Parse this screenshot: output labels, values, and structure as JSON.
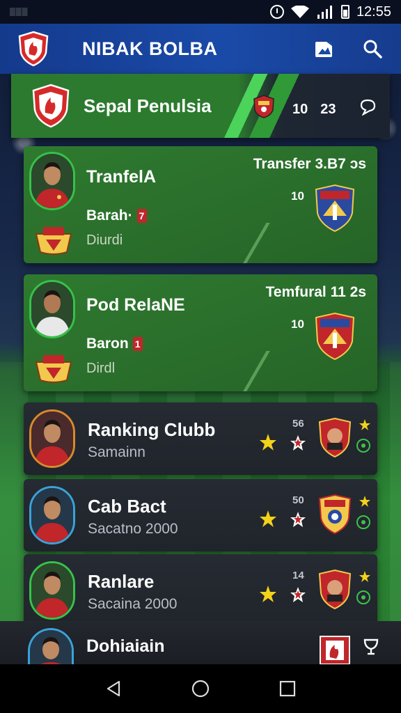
{
  "status_bar": {
    "carrier": "▒▒▒",
    "time": "12:55"
  },
  "app_bar": {
    "title": "NIBAK BOLBA"
  },
  "feature": {
    "title": "Sepal Penulsia",
    "score_left": "10",
    "score_right": "23"
  },
  "transfers": [
    {
      "name": "TranfelA",
      "right_title": "Transfer 3.B7 ɔs",
      "right_num": "10",
      "sub": "Barah·",
      "chip": "7",
      "sub2": "Diurdi"
    },
    {
      "name": "Pod RelaNE",
      "right_title": "Temfural 11 2s",
      "right_num": "10",
      "sub": "Baron",
      "chip": "1",
      "sub2": "Dirdl"
    }
  ],
  "rankings": [
    {
      "name": "Ranking Clubb",
      "sub": "Samainn",
      "num": "56"
    },
    {
      "name": "Cab Bact",
      "sub": "Sacatno 2000",
      "num": "50"
    },
    {
      "name": "Ranlare",
      "sub": "Sacaina 2000",
      "num": "14"
    }
  ],
  "bottom_card": {
    "name": "Dohiaiain"
  },
  "colors": {
    "appbar_blue": "#1a4aa8",
    "card_green": "#2c7a2f",
    "card_dark": "#23272e",
    "star_yellow": "#f3d21a",
    "chip_red": "#c0262a"
  },
  "icons": {
    "app_logo": "shield-logo-icon",
    "appbar_action_1": "edit-image-icon",
    "appbar_action_2": "search-icon",
    "feature_right": "chat-icon",
    "bottom_right": "trophy-icon",
    "nav": [
      "back-icon",
      "home-icon",
      "recents-icon"
    ]
  }
}
